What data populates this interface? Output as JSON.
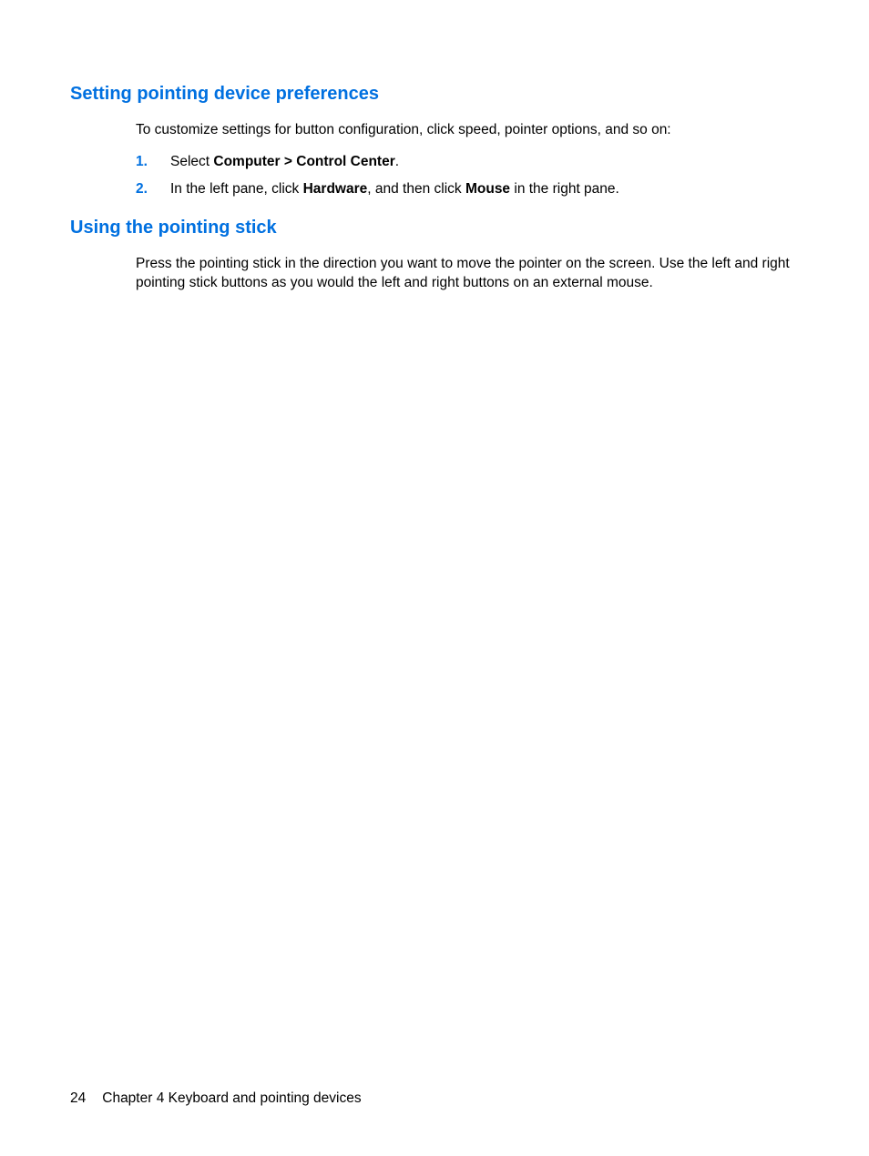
{
  "section1": {
    "heading": "Setting pointing device preferences",
    "intro": "To customize settings for button configuration, click speed, pointer options, and so on:",
    "steps": [
      {
        "number": "1.",
        "prefix": "Select ",
        "bold1": "Computer > Control Center",
        "suffix": "."
      },
      {
        "number": "2.",
        "prefix": "In the left pane, click ",
        "bold1": "Hardware",
        "mid": ", and then click ",
        "bold2": "Mouse",
        "suffix": " in the right pane."
      }
    ]
  },
  "section2": {
    "heading": "Using the pointing stick",
    "body": "Press the pointing stick in the direction you want to move the pointer on the screen. Use the left and right pointing stick buttons as you would the left and right buttons on an external mouse."
  },
  "footer": {
    "page": "24",
    "chapter": "Chapter 4   Keyboard and pointing devices"
  }
}
